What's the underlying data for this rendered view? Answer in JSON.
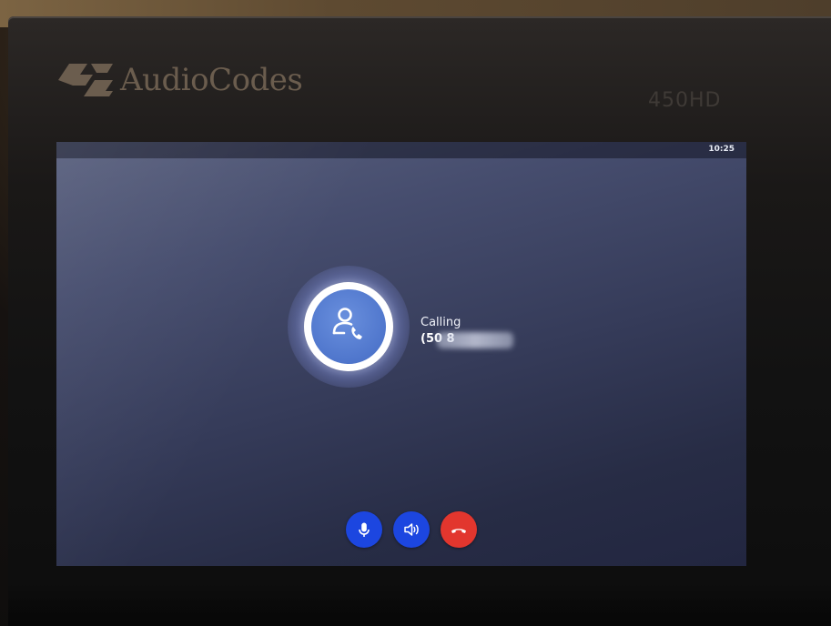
{
  "device": {
    "brand": "AudioCodes",
    "model": "450HD",
    "logo_icon": "audiocodes-logo-icon"
  },
  "status_bar": {
    "time": "10:25"
  },
  "call": {
    "status": "Calling",
    "number_visible": "(50          8",
    "avatar_icon": "contact-phone-icon"
  },
  "controls": [
    {
      "name": "mute",
      "icon": "microphone-icon",
      "color": "#1c46e0"
    },
    {
      "name": "speaker",
      "icon": "speaker-icon",
      "color": "#1c46e0"
    },
    {
      "name": "end-call",
      "icon": "hang-up-icon",
      "color": "#e2362e"
    }
  ],
  "colors": {
    "screen_background": "#3a4060",
    "avatar": "#4f76cc",
    "action_blue": "#1c46e0",
    "action_red": "#e2362e"
  }
}
